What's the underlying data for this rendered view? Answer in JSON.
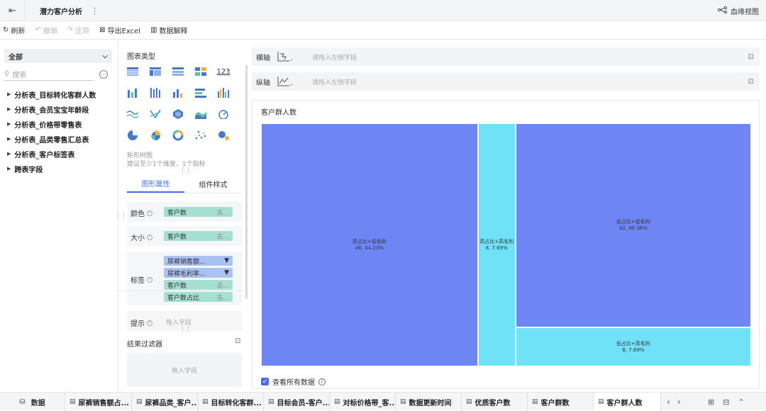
{
  "header": {
    "title": "潜力客户分析",
    "lineage_label": "血缘视图"
  },
  "toolbar": {
    "refresh": "刷新",
    "undo": "撤销",
    "redo": "还原",
    "export": "导出Excel",
    "explain": "数据解释"
  },
  "left_panel": {
    "scope": "全部",
    "search_placeholder": "搜索",
    "tables": [
      "分析表_目标转化客群人数",
      "分析表_会员宝宝年龄段",
      "分析表_价格带零售表",
      "分析表_品类零售汇总表",
      "分析表_客户标签表",
      "跨表字段"
    ]
  },
  "chart_types": {
    "label": "图表类型",
    "icons": [
      "table-icon",
      "cross-table-icon",
      "detail-table-icon",
      "block-table-icon",
      "kpi-number-icon",
      "grouped-bar-icon",
      "stacked-bar-icon",
      "column-icon",
      "horizontal-bar-icon",
      "multi-column-icon",
      "line-icon",
      "radar-line-icon",
      "polygon-icon",
      "area-icon",
      "gauge-icon",
      "pie-icon",
      "rose-pie-icon",
      "donut-icon",
      "scatter-icon",
      "bubble-icon"
    ],
    "kpi_text": "123",
    "selected_name": "矩形树图",
    "hint": "建议至少1个维度，1个指标"
  },
  "properties": {
    "tabs": [
      "图形属性",
      "组件样式"
    ],
    "color_label": "颜色",
    "color_field": "客户数",
    "size_label": "大小",
    "size_field": "客户数",
    "label_label": "标签",
    "label_fields": [
      {
        "name": "尿裤销售额...",
        "kind": "filter"
      },
      {
        "name": "尿裤毛利率...",
        "kind": "filter"
      },
      {
        "name": "客户数",
        "kind": "suffix"
      },
      {
        "name": "客户数占比",
        "kind": "suffix"
      }
    ],
    "suffix": "去...",
    "tooltip_label": "提示",
    "tooltip_placeholder": "拖入字段",
    "result_filter_label": "结果过滤器",
    "result_filter_placeholder": "拖入字段"
  },
  "axes": {
    "x_label": "横轴",
    "y_label": "纵轴",
    "placeholder": "请拖入左侧字段"
  },
  "chart": {
    "title": "客户群人数",
    "view_all": "查看所有数据"
  },
  "chart_data": {
    "type": "treemap",
    "title": "客户群人数",
    "nodes": [
      {
        "name": "高占比+低毛利",
        "value": 46,
        "share": "44.23%",
        "color": "#6d86f4"
      },
      {
        "name": "高占比+高毛利",
        "value": 8,
        "share": "7.69%",
        "color": "#6fe2f8"
      },
      {
        "name": "低占比+低毛利",
        "value": 42,
        "share": "40.38%",
        "color": "#6d86f4"
      },
      {
        "name": "低占比+高毛利",
        "value": 8,
        "share": "7.69%",
        "color": "#6fe2f8"
      }
    ]
  },
  "bottom_tabs": {
    "data_label": "数据",
    "tabs": [
      "尿裤销售额占...",
      "尿裤品类_客户...",
      "目标转化客群...",
      "目标会员-客户...",
      "对标价格带_客...",
      "数据更新时间",
      "优质客户数",
      "客户群数",
      "客户群人数"
    ],
    "active": 8
  }
}
